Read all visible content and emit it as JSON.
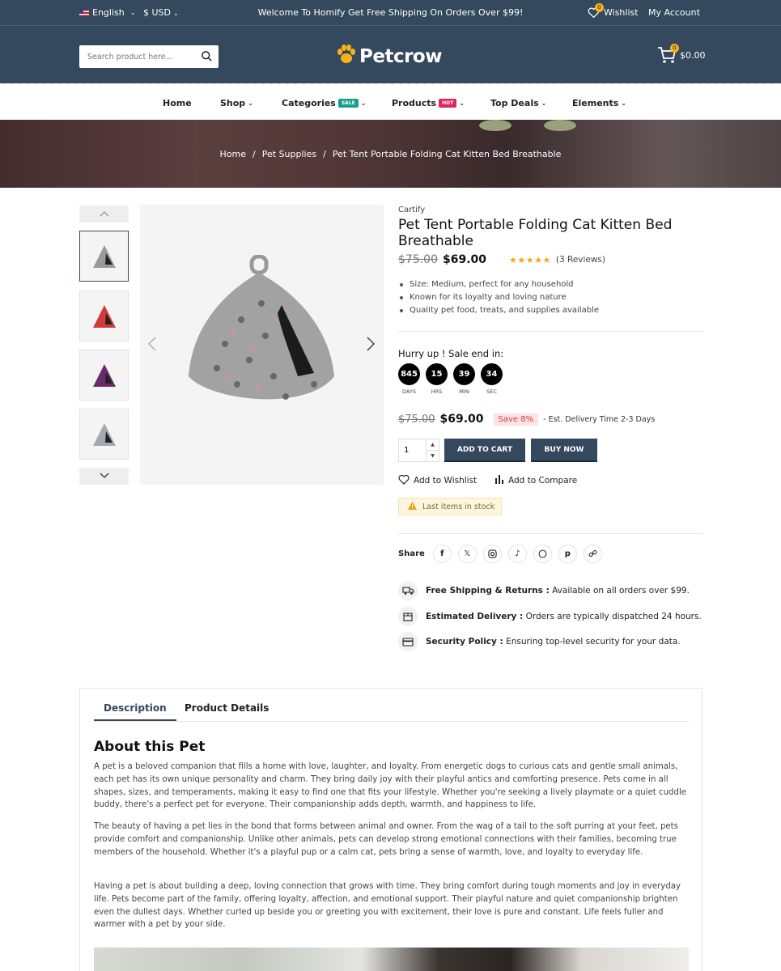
{
  "topbar": {
    "language": "English",
    "currency": "$ USD",
    "welcome": "Welcome To Homify Get Free Shipping On Orders Over $99!",
    "wishlist_label": "Wishlist",
    "wishlist_count": "0",
    "account_label": "My Account"
  },
  "header": {
    "search_placeholder": "Search product here...",
    "logo_text": "Petcrow",
    "cart_total": "$0.00",
    "cart_count": "0"
  },
  "nav": {
    "items": [
      {
        "label": "Home"
      },
      {
        "label": "Shop"
      },
      {
        "label": "Categories",
        "tag": "SALE",
        "tag_color": "#1a9c8c"
      },
      {
        "label": "Products",
        "tag": "HOT",
        "tag_color": "#e0245e"
      },
      {
        "label": "Top Deals"
      },
      {
        "label": "Elements"
      }
    ]
  },
  "breadcrumb": [
    "Home",
    "Pet Supplies",
    "Pet Tent Portable Folding Cat Kitten Bed Breathable"
  ],
  "product": {
    "brand": "Cartify",
    "title": "Pet Tent Portable Folding Cat Kitten Bed Breathable",
    "old_price": "$75.00",
    "price": "$69.00",
    "rating": 5,
    "stars": "★★★★★",
    "reviews": "(3 Reviews)",
    "features": [
      "Size: Medium, perfect for any household",
      "Known for its loyalty and loving nature",
      "Quality pet food, treats, and supplies available"
    ],
    "sale_title": "Hurry up ! Sale end in:",
    "countdown": [
      {
        "value": "845",
        "label": "DAYS"
      },
      {
        "value": "15",
        "label": "HRS"
      },
      {
        "value": "39",
        "label": "MIN"
      },
      {
        "value": "34",
        "label": "SEC"
      }
    ],
    "save_badge": "Save 8%",
    "delivery_note": "- Est. Delivery Time 2-3 Days",
    "quantity": "1",
    "add_to_cart": "ADD TO CART",
    "buy_now": "BUY NOW",
    "add_to_wishlist": "Add to Wishlist",
    "add_to_compare": "Add to Compare",
    "stock_note": "Last items in stock",
    "share_label": "Share",
    "thumb_colors": [
      "#9a9a9a",
      "#d23a3a",
      "#6b2a6e",
      "#a7a6b4"
    ]
  },
  "policies": [
    {
      "title": "Free Shipping & Returns :",
      "text": "Available on all orders over $99."
    },
    {
      "title": "Estimated Delivery :",
      "text": "Orders are typically dispatched 24 hours."
    },
    {
      "title": "Security Policy :",
      "text": "Ensuring top-level security for your data."
    }
  ],
  "tabs": [
    "Description",
    "Product Details"
  ],
  "description": {
    "heading": "About this Pet",
    "paragraphs": [
      "A pet is a beloved companion that fills a home with love, laughter, and loyalty. From energetic dogs to curious cats and gentle small animals, each pet has its own unique personality and charm. They bring daily joy with their playful antics and comforting presence. Pets come in all shapes, sizes, and temperaments, making it easy to find one that fits your lifestyle. Whether you're seeking a lively playmate or a quiet cuddle buddy, there's a perfect pet for everyone. Their companionship adds depth, warmth, and happiness to life.",
      "The beauty of having a pet lies in the bond that forms between animal and owner. From the wag of a tail to the soft purring at your feet, pets provide comfort and companionship. Unlike other animals, pets can develop strong emotional connections with their families, becoming true members of the household. Whether it's a playful pup or a calm cat, pets bring a sense of warmth, love, and loyalty to everyday life.",
      "Having a pet is about building a deep, loving connection that grows with time. They bring comfort during tough moments and joy in everyday life. Pets become part of the family, offering loyalty, affection, and emotional support. Their playful nature and quiet companionship brighten even the dullest days. Whether curled up beside you or greeting you with excitement, their love is pure and constant. Life feels fuller and warmer with a pet by your side."
    ]
  }
}
